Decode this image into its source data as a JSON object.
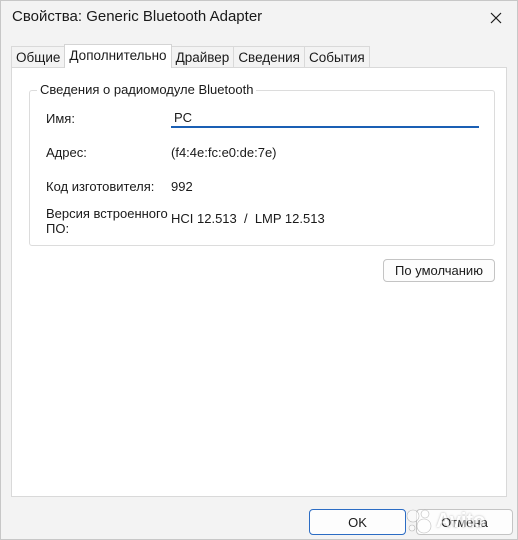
{
  "window": {
    "title": "Свойства: Generic Bluetooth Adapter",
    "close_icon": "close-icon"
  },
  "tabs": [
    {
      "label": "Общие",
      "active": false
    },
    {
      "label": "Дополнительно",
      "active": true
    },
    {
      "label": "Драйвер",
      "active": false
    },
    {
      "label": "Сведения",
      "active": false
    },
    {
      "label": "События",
      "active": false
    }
  ],
  "group": {
    "legend": "Сведения о радиомодуле Bluetooth",
    "name_label": "Имя:",
    "name_value": "PC",
    "address_label": "Адрес:",
    "address_value": "(f4:4e:fc:e0:de:7e)",
    "manufacturer_label": "Код изготовителя:",
    "manufacturer_value": "992",
    "firmware_label_line1": "Версия встроенного",
    "firmware_label_line2": "ПО:",
    "firmware_value": "HCI 12.513  /  LMP 12.513"
  },
  "buttons": {
    "default": "По умолчанию",
    "ok": "OK",
    "cancel": "Отмена"
  },
  "watermark": {
    "text": "Avito"
  },
  "colors": {
    "accent": "#1a5fb4",
    "window_bg": "#f3f3f3",
    "panel_bg": "#ffffff"
  }
}
